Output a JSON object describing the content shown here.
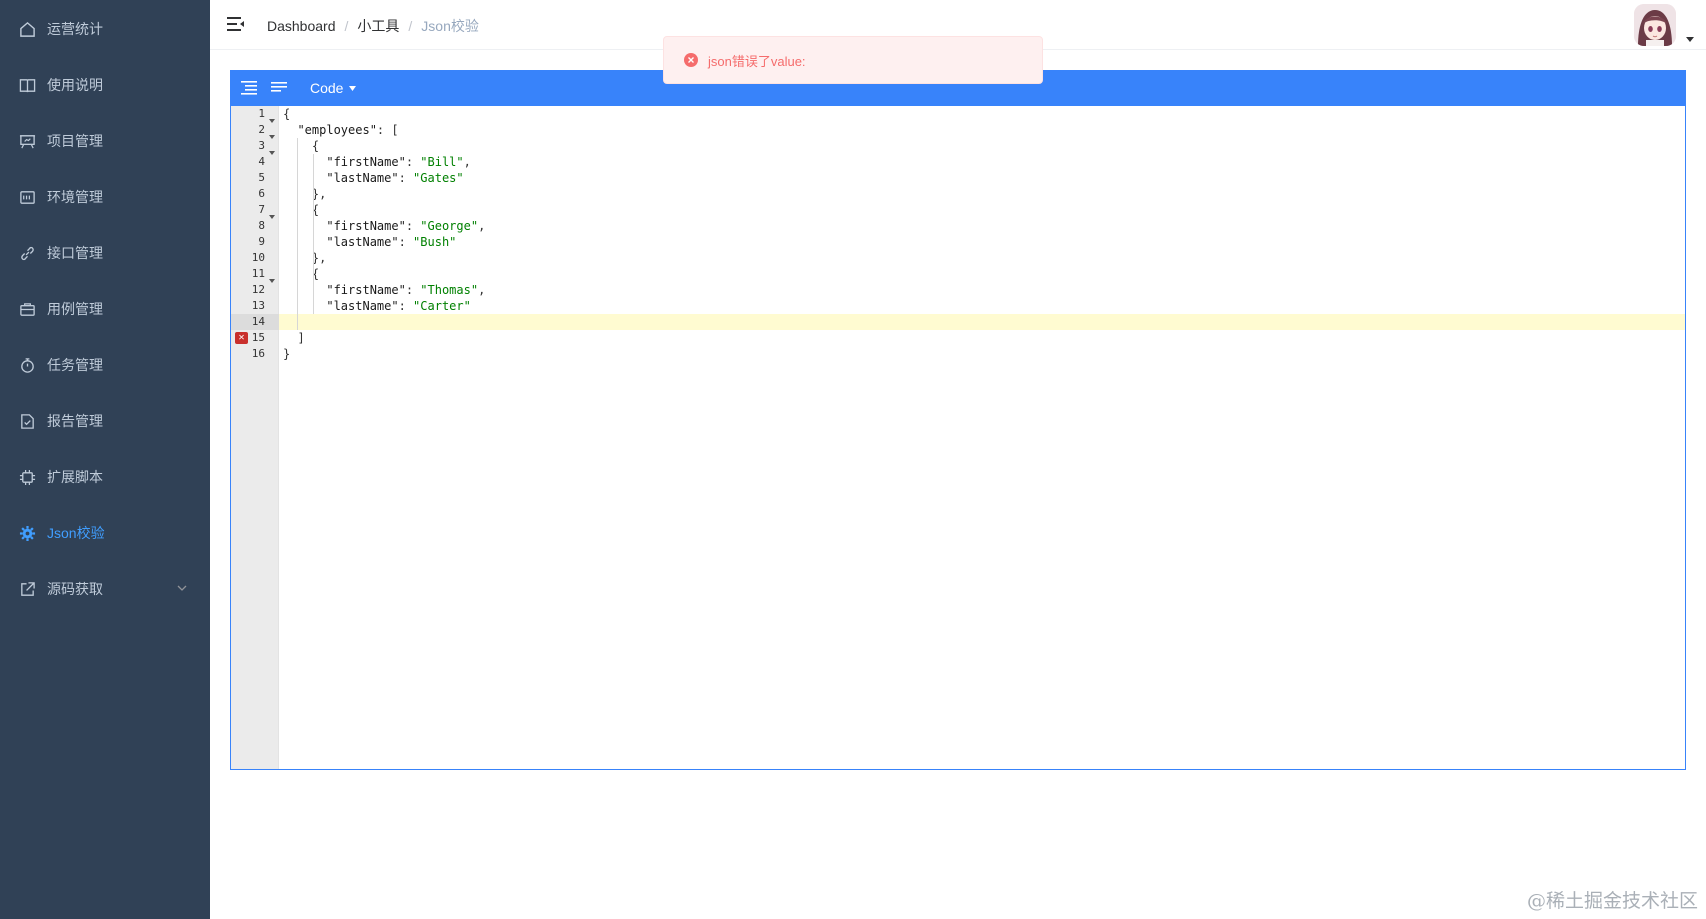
{
  "sidebar": {
    "items": [
      {
        "label": "运营统计",
        "icon": "home-icon"
      },
      {
        "label": "使用说明",
        "icon": "book-icon"
      },
      {
        "label": "项目管理",
        "icon": "presentation-icon"
      },
      {
        "label": "环境管理",
        "icon": "server-icon"
      },
      {
        "label": "接口管理",
        "icon": "link-icon"
      },
      {
        "label": "用例管理",
        "icon": "briefcase-icon"
      },
      {
        "label": "任务管理",
        "icon": "stopwatch-icon"
      },
      {
        "label": "报告管理",
        "icon": "document-check-icon"
      },
      {
        "label": "扩展脚本",
        "icon": "cpu-icon"
      },
      {
        "label": "Json校验",
        "icon": "gear-icon"
      },
      {
        "label": "源码获取",
        "icon": "external-link-icon"
      }
    ],
    "active_index": 9,
    "colors": {
      "bg": "#304156",
      "text": "#bfcbd9",
      "active": "#409eff"
    }
  },
  "breadcrumb": [
    "Dashboard",
    "小工具",
    "Json校验"
  ],
  "toast": {
    "text": "json错误了value:",
    "type": "error",
    "icon": "error-circle-icon"
  },
  "editor": {
    "mode_label": "Code",
    "accent": "#3883fa",
    "error_line": 15,
    "active_line": 14,
    "lines": [
      [
        [
          "pun",
          "{"
        ]
      ],
      [
        [
          "key",
          "  \"employees\""
        ],
        [
          "pun",
          ": ["
        ]
      ],
      [
        [
          "pun",
          "    {"
        ]
      ],
      [
        [
          "key",
          "      \"firstName\""
        ],
        [
          "pun",
          ": "
        ],
        [
          "str",
          "\"Bill\""
        ],
        [
          "pun",
          ","
        ]
      ],
      [
        [
          "key",
          "      \"lastName\""
        ],
        [
          "pun",
          ": "
        ],
        [
          "str",
          "\"Gates\""
        ]
      ],
      [
        [
          "pun",
          "    },"
        ]
      ],
      [
        [
          "pun",
          "    {"
        ]
      ],
      [
        [
          "key",
          "      \"firstName\""
        ],
        [
          "pun",
          ": "
        ],
        [
          "str",
          "\"George\""
        ],
        [
          "pun",
          ","
        ]
      ],
      [
        [
          "key",
          "      \"lastName\""
        ],
        [
          "pun",
          ": "
        ],
        [
          "str",
          "\"Bush\""
        ]
      ],
      [
        [
          "pun",
          "    },"
        ]
      ],
      [
        [
          "pun",
          "    {"
        ]
      ],
      [
        [
          "key",
          "      \"firstName\""
        ],
        [
          "pun",
          ": "
        ],
        [
          "str",
          "\"Thomas\""
        ],
        [
          "pun",
          ","
        ]
      ],
      [
        [
          "key",
          "      \"lastName\""
        ],
        [
          "pun",
          ": "
        ],
        [
          "str",
          "\"Carter\""
        ]
      ],
      [],
      [
        [
          "pun",
          "  ]"
        ]
      ],
      [
        [
          "pun",
          "}"
        ]
      ]
    ],
    "fold_lines": [
      1,
      2,
      3,
      7,
      11
    ]
  },
  "watermark": "@稀土掘金技术社区"
}
